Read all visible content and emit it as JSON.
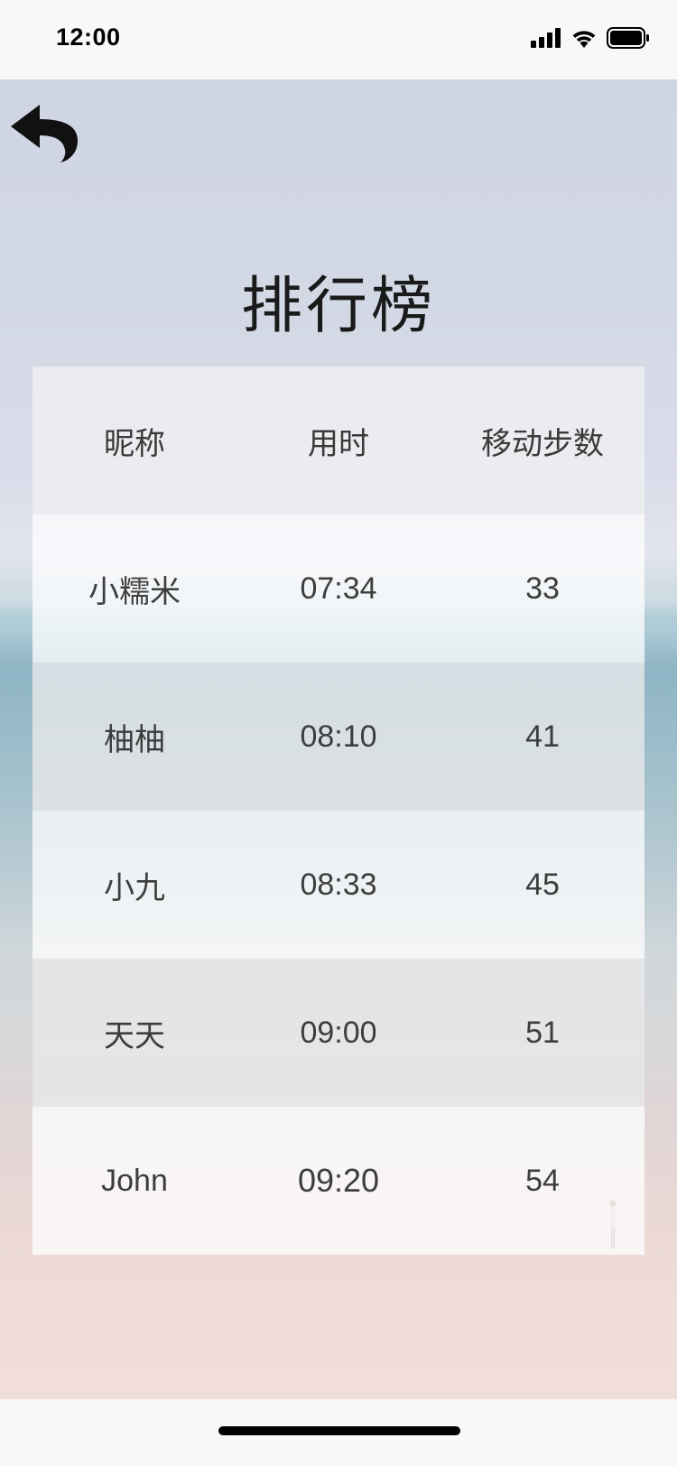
{
  "status_bar": {
    "time": "12:00",
    "icons": [
      "signal-icon",
      "wifi-icon",
      "battery-icon"
    ]
  },
  "back_icon": "back-arrow-icon",
  "title": "排行榜",
  "leaderboard": {
    "headers": [
      "昵称",
      "用时",
      "移动步数"
    ],
    "rows": [
      {
        "name": "小糯米",
        "time": "07:34",
        "moves": "33"
      },
      {
        "name": "柚柚",
        "time": "08:10",
        "moves": "41"
      },
      {
        "name": "小九",
        "time": "08:33",
        "moves": "45"
      },
      {
        "name": "天天",
        "time": "09:00",
        "moves": "51"
      },
      {
        "name": "John",
        "time": "09:20",
        "moves": "54"
      }
    ]
  },
  "colors": {
    "status_bar_bg": "#f8f8f8",
    "title_text": "#1a1a1a",
    "cell_text": "#3d3d3d",
    "sky": "#d0d5e3",
    "sea": "#8fb5c6",
    "sand": "#f0dcd8"
  }
}
